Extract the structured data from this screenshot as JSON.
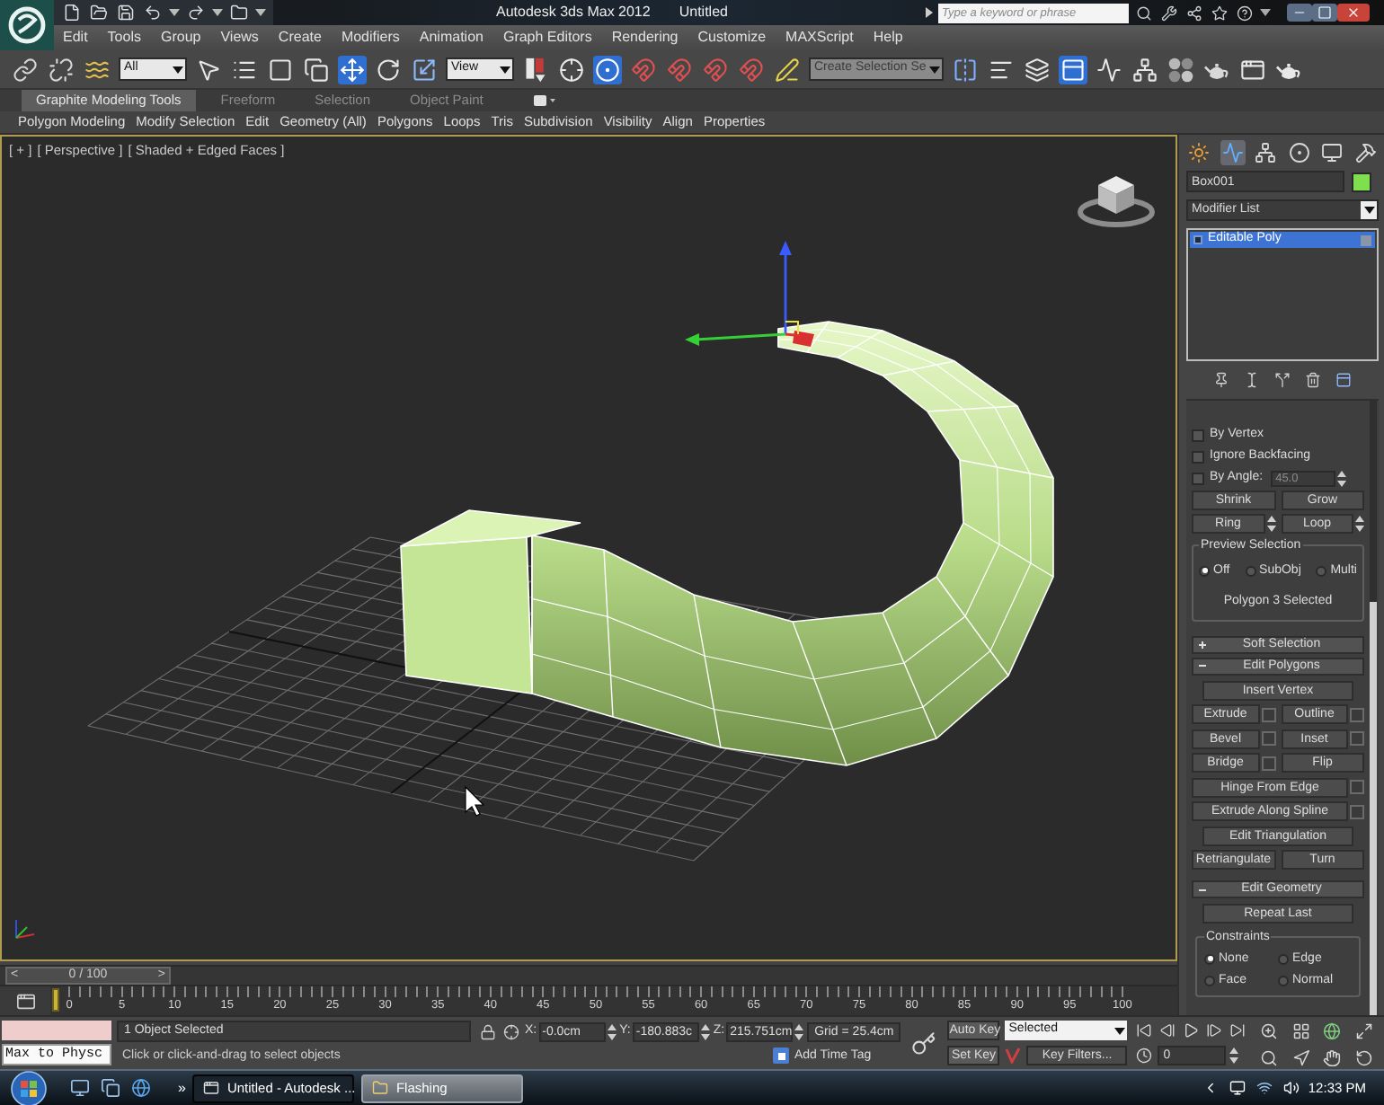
{
  "window": {
    "title": "Autodesk 3ds Max 2012",
    "document": "Untitled"
  },
  "search": {
    "placeholder": "Type a keyword or phrase"
  },
  "menu": [
    "Edit",
    "Tools",
    "Group",
    "Views",
    "Create",
    "Modifiers",
    "Animation",
    "Graph Editors",
    "Rendering",
    "Customize",
    "MAXScript",
    "Help"
  ],
  "toolbar": [
    {
      "kind": "link",
      "on": false
    },
    {
      "kind": "unlink",
      "on": false
    },
    {
      "kind": "bind",
      "on": false
    },
    {
      "kind": "dropdown",
      "value": "All",
      "disabled": false
    },
    {
      "kind": "select",
      "on": false
    },
    {
      "kind": "select-by-name",
      "on": false
    },
    {
      "kind": "rect-region",
      "on": false
    },
    {
      "kind": "window-crossing",
      "on": false
    },
    {
      "kind": "move",
      "on": true
    },
    {
      "kind": "rotate",
      "on": false
    },
    {
      "kind": "scale",
      "on": false
    },
    {
      "kind": "dropdown",
      "value": "View",
      "disabled": false
    },
    {
      "kind": "pivot",
      "on": false
    },
    {
      "kind": "manipulate",
      "on": false
    },
    {
      "kind": "shortcut-override",
      "on": true
    },
    {
      "kind": "snap",
      "on": false
    },
    {
      "kind": "angle-snap",
      "on": false
    },
    {
      "kind": "percent-snap",
      "on": false
    },
    {
      "kind": "spinner-snap",
      "on": false
    },
    {
      "kind": "edit-named",
      "on": false
    },
    {
      "kind": "dropdown",
      "value": "Create Selection Se",
      "disabled": true
    },
    {
      "kind": "mirror",
      "on": false
    },
    {
      "kind": "align",
      "on": false
    },
    {
      "kind": "layers",
      "on": false
    },
    {
      "kind": "ribbon-toggle",
      "on": true
    },
    {
      "kind": "curve-editor",
      "on": false
    },
    {
      "kind": "schematic",
      "on": false
    },
    {
      "kind": "material-editor",
      "on": false
    },
    {
      "kind": "render-setup",
      "on": false
    },
    {
      "kind": "frame-window",
      "on": false
    },
    {
      "kind": "render",
      "on": false
    }
  ],
  "ribbon": {
    "tabs": [
      {
        "label": "Graphite Modeling Tools",
        "selected": true
      },
      {
        "label": "Freeform",
        "selected": false
      },
      {
        "label": "Selection",
        "selected": false
      },
      {
        "label": "Object Paint",
        "selected": false
      }
    ],
    "panels": [
      "Polygon Modeling",
      "Modify Selection",
      "Edit",
      "Geometry (All)",
      "Polygons",
      "Loops",
      "Tris",
      "Subdivision",
      "Visibility",
      "Align",
      "Properties"
    ]
  },
  "viewport": {
    "labels": [
      "[ + ]",
      "[ Perspective ]",
      "[ Shaded + Edged Faces ]"
    ],
    "active": true
  },
  "command_panel": {
    "tabs": [
      {
        "kind": "create",
        "selected": false
      },
      {
        "kind": "modify",
        "selected": true
      },
      {
        "kind": "hierarchy",
        "selected": false
      },
      {
        "kind": "motion",
        "selected": false
      },
      {
        "kind": "display",
        "selected": false
      },
      {
        "kind": "utilities",
        "selected": false
      }
    ],
    "object_name": "Box001",
    "modifier_list": "Modifier List",
    "stack": [
      {
        "label": "Editable Poly",
        "selected": true
      }
    ],
    "selection": {
      "checks": [
        {
          "label": "By Vertex",
          "checked": false
        },
        {
          "label": "Ignore Backfacing",
          "checked": false
        },
        {
          "label": "By Angle:",
          "checked": false,
          "value": "45.0"
        }
      ],
      "buttons": [
        {
          "label": "Shrink",
          "spinner": false
        },
        {
          "label": "Grow",
          "spinner": false
        },
        {
          "label": "Ring",
          "spinner": true
        },
        {
          "label": "Loop",
          "spinner": true
        }
      ],
      "preview": {
        "title": "Preview Selection",
        "options": [
          {
            "label": "Off",
            "selected": true
          },
          {
            "label": "SubObj",
            "selected": false
          },
          {
            "label": "Multi",
            "selected": false
          }
        ]
      },
      "status": "Polygon 3 Selected"
    },
    "rollouts": [
      {
        "title": "Soft Selection",
        "expanded": false
      },
      {
        "title": "Edit Polygons",
        "expanded": true,
        "rows": [
          [
            {
              "label": "Insert Vertex",
              "settings": false
            }
          ],
          [
            {
              "label": "Extrude",
              "settings": true
            },
            {
              "label": "Outline",
              "settings": true
            }
          ],
          [
            {
              "label": "Bevel",
              "settings": true
            },
            {
              "label": "Inset",
              "settings": true
            }
          ],
          [
            {
              "label": "Bridge",
              "settings": true
            },
            {
              "label": "Flip",
              "settings": false
            }
          ],
          [
            {
              "label": "Hinge From Edge",
              "settings": true
            }
          ],
          [
            {
              "label": "Extrude Along Spline",
              "settings": true
            }
          ],
          [
            {
              "label": "Edit Triangulation",
              "settings": false
            }
          ],
          [
            {
              "label": "Retriangulate",
              "settings": false
            },
            {
              "label": "Turn",
              "settings": false
            }
          ]
        ]
      },
      {
        "title": "Edit Geometry",
        "expanded": true,
        "rows": [
          [
            {
              "label": "Repeat Last",
              "settings": false
            }
          ]
        ],
        "group": {
          "title": "Constraints",
          "options": [
            {
              "label": "None",
              "selected": true
            },
            {
              "label": "Edge",
              "selected": false
            },
            {
              "label": "Face",
              "selected": false
            },
            {
              "label": "Normal",
              "selected": false
            }
          ]
        }
      }
    ]
  },
  "timeline": {
    "prev": "<",
    "position": "0 / 100",
    "next": ">",
    "level": 0,
    "ticks": [
      "0",
      "5",
      "10",
      "15",
      "20",
      "25",
      "30",
      "35",
      "40",
      "45",
      "50",
      "55",
      "60",
      "65",
      "70",
      "75",
      "80",
      "85",
      "90",
      "95",
      "100"
    ]
  },
  "status": {
    "listener_output": "Max to Physc",
    "selection": "1 Object Selected",
    "prompt": "Click or click-and-drag to select objects",
    "coords": [
      {
        "axis": "X:",
        "value": "-0.0cm"
      },
      {
        "axis": "Y:",
        "value": "-180.883c"
      },
      {
        "axis": "Z:",
        "value": "215.751cm"
      }
    ],
    "grid": "Grid = 25.4cm",
    "time_tag": "Add Time Tag"
  },
  "animation": {
    "auto_key": "Auto Key",
    "key_mode": "Selected",
    "set_key": "Set Key",
    "key_filters": "Key Filters...",
    "frame": "0"
  },
  "taskbar": {
    "more": "»",
    "windows": [
      {
        "label": "Untitled - Autodesk ...",
        "selected": true
      },
      {
        "label": "Flashing",
        "selected": false
      }
    ],
    "clock": "12:33 PM"
  }
}
